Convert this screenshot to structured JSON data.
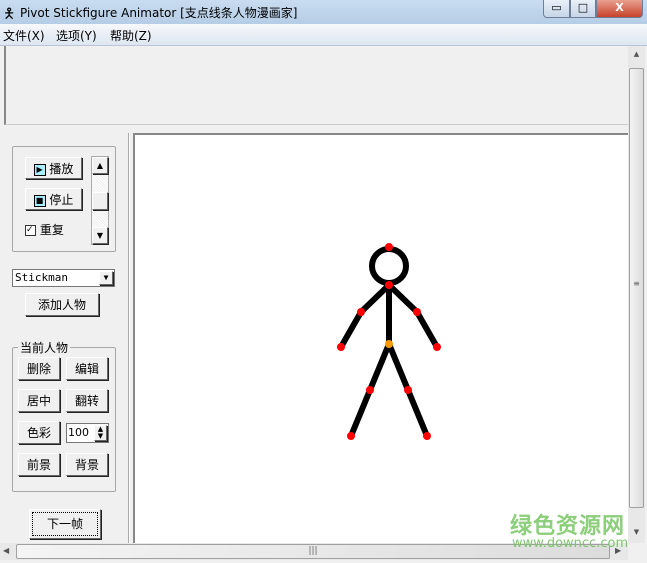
{
  "window": {
    "title": "Pivot Stickfigure Animator [支点线条人物漫画家]",
    "minimize": "▭",
    "maximize": "□",
    "close": "X"
  },
  "menu": [
    "文件(X)",
    "选项(Y)",
    "帮助(Z)"
  ],
  "playback": {
    "play": "播放",
    "stop": "停止",
    "repeat": "重复",
    "repeat_checked": true
  },
  "figure_select": {
    "value": "Stickman"
  },
  "add_figure": "添加人物",
  "current_figure": {
    "title": "当前人物",
    "delete": "删除",
    "edit": "编辑",
    "center": "居中",
    "flip": "翻转",
    "color": "色彩",
    "opacity": "100",
    "front": "前景",
    "back": "背景"
  },
  "next_frame": "下一帧",
  "colors": {
    "figure": "#000000",
    "joint": "#ff0000",
    "root_joint": "#ff9900"
  },
  "watermark": {
    "name": "绿色资源网",
    "url": "www.downcc.com"
  }
}
